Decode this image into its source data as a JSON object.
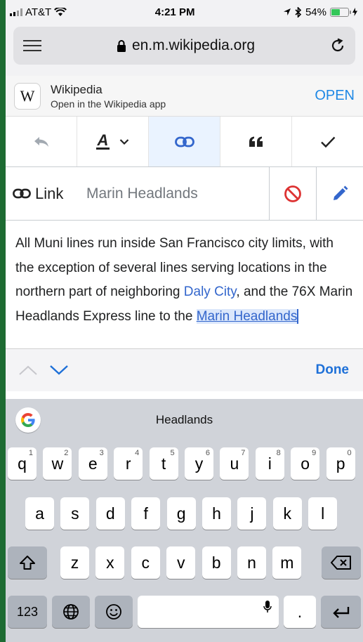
{
  "status": {
    "carrier": "AT&T",
    "time": "4:21 PM",
    "battery": "54%",
    "battery_level": 0.54
  },
  "browser": {
    "url": "en.m.wikipedia.org"
  },
  "banner": {
    "logo": "W",
    "title": "Wikipedia",
    "subtitle": "Open in the Wikipedia app",
    "open_label": "OPEN"
  },
  "toolbar": {
    "items": [
      "undo-icon",
      "text-style-icon",
      "link-icon",
      "quote-icon",
      "checkmark-icon"
    ],
    "active": "link-icon"
  },
  "link": {
    "label": "Link",
    "value": "Marin Headlands"
  },
  "content": {
    "t1": "All Muni lines run inside San Francisco city limits, with the exception of several lines serving locations in the northern part of neighboring ",
    "link1": "Daly City",
    "t2": ", and the 76X Marin Headlands Express line to the ",
    "link2": "Marin Headlands"
  },
  "accessory": {
    "done_label": "Done"
  },
  "keyboard": {
    "suggestion": "Headlands",
    "row1": [
      "q",
      "w",
      "e",
      "r",
      "t",
      "y",
      "u",
      "i",
      "o",
      "p"
    ],
    "row1_hints": [
      "1",
      "2",
      "3",
      "4",
      "5",
      "6",
      "7",
      "8",
      "9",
      "0"
    ],
    "row2": [
      "a",
      "s",
      "d",
      "f",
      "g",
      "h",
      "j",
      "k",
      "l"
    ],
    "row3": [
      "z",
      "x",
      "c",
      "v",
      "b",
      "n",
      "m"
    ],
    "numbers_label": "123",
    "period_label": "."
  }
}
